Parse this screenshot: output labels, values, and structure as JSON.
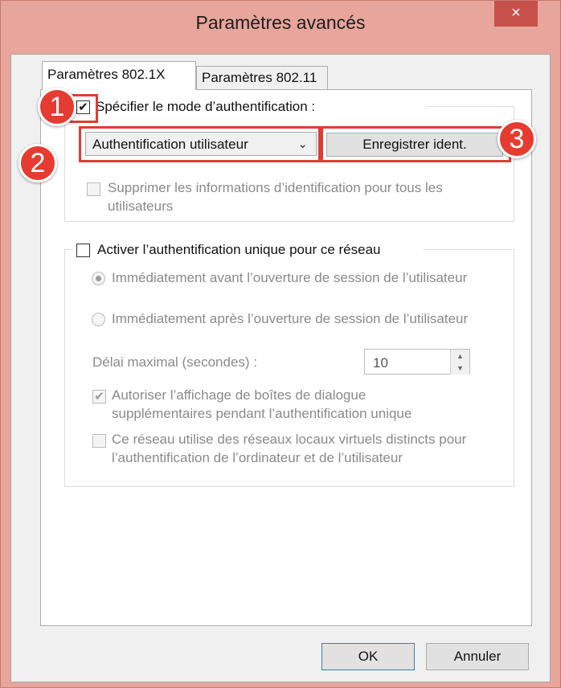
{
  "window": {
    "title": "Paramètres avancés",
    "close_glyph": "×"
  },
  "tabs": [
    {
      "label": "Paramètres 802.1X",
      "active": true
    },
    {
      "label": "Paramètres 802.11",
      "active": false
    }
  ],
  "auth_section": {
    "specify_mode_label": "Spécifier le mode d’authentification :",
    "specify_mode_checked": true,
    "mode_select_value": "Authentification utilisateur",
    "save_credentials_button": "Enregistrer ident.",
    "delete_credentials_label_line1": "Supprimer les informations d’identification pour tous les",
    "delete_credentials_label_line2": "utilisateurs",
    "delete_credentials_checked": false
  },
  "sso_section": {
    "enable_sso_label": "Activer l’authentification unique pour ce réseau",
    "enable_sso_checked": false,
    "radio_before_label": "Immédiatement avant l’ouverture de session de l’utilisateur",
    "radio_before_selected": true,
    "radio_after_label": "Immédiatement après l’ouverture de session de l’utilisateur",
    "radio_after_selected": false,
    "max_delay_label": "Délai maximal (secondes) :",
    "max_delay_value": "10",
    "allow_dialogs_line1": "Autoriser l’affichage de boîtes de dialogue",
    "allow_dialogs_line2": "supplémentaires pendant l’authentification unique",
    "allow_dialogs_checked": true,
    "vlan_line1": "Ce réseau utilise des réseaux locaux virtuels distincts pour",
    "vlan_line2": "l’authentification de l’ordinateur et de l’utilisateur",
    "vlan_checked": false
  },
  "footer": {
    "ok_label": "OK",
    "cancel_label": "Annuler"
  },
  "annotations": {
    "badge_1": "1",
    "badge_2": "2",
    "badge_3": "3",
    "color": "#e03c35"
  },
  "colors": {
    "title_bar": "#e7a59b",
    "close_button": "#c7504b",
    "panel": "#ffffff",
    "dialog_background": "#f0f0f0"
  }
}
